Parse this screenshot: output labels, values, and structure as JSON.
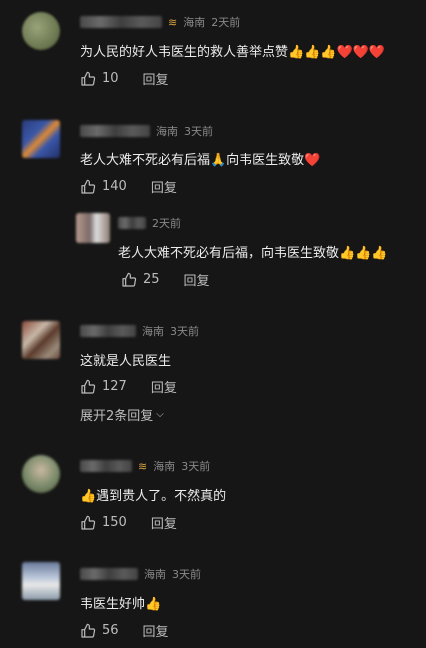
{
  "comments": [
    {
      "location": "海南",
      "time": "2天前",
      "text": "为人民的好人韦医生的救人善举点赞👍👍👍❤️❤️❤️",
      "likes": "10",
      "reply_label": "回复",
      "badge_icon": "vip-badge-icon"
    },
    {
      "location": "海南",
      "time": "3天前",
      "text": "老人大难不死必有后福🙏向韦医生致敬❤️",
      "likes": "140",
      "reply_label": "回复"
    },
    {
      "time": "2天前",
      "text": "老人大难不死必有后福，向韦医生致敬👍👍👍",
      "likes": "25",
      "reply_label": "回复"
    },
    {
      "location": "海南",
      "time": "3天前",
      "text": "这就是人民医生",
      "likes": "127",
      "reply_label": "回复",
      "expand_label": "展开2条回复"
    },
    {
      "location": "海南",
      "time": "3天前",
      "text": "👍遇到贵人了。不然真的",
      "likes": "150",
      "reply_label": "回复",
      "badge_icon": "vip-badge-icon"
    },
    {
      "location": "海南",
      "time": "3天前",
      "text": "韦医生好帅👍",
      "likes": "56",
      "reply_label": "回复"
    }
  ],
  "icons": {
    "like": "thumbs-up-outline-icon",
    "expand": "chevron-down-icon"
  },
  "colors": {
    "background": "#161616",
    "text": "#ececec",
    "meta": "#8a8a8a",
    "badge": "#d9a441"
  }
}
